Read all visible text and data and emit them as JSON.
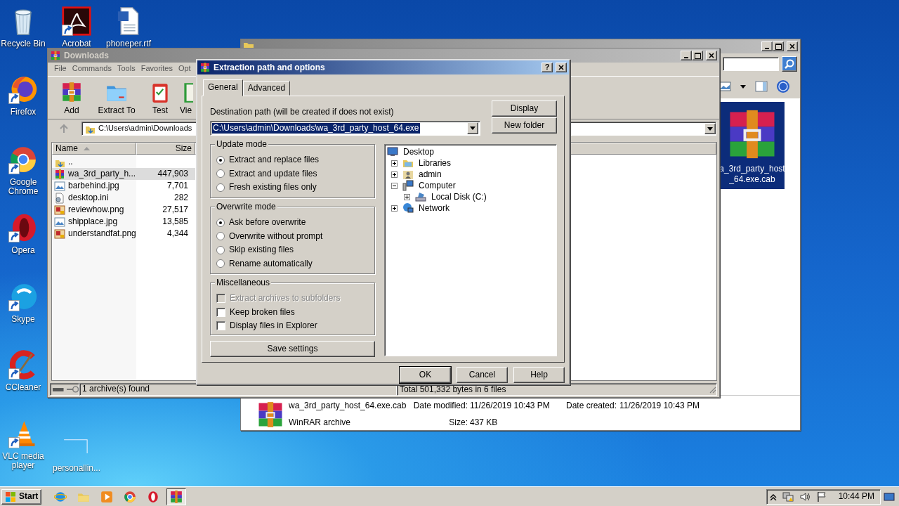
{
  "desktop_icons": [
    {
      "label": "Recycle Bin",
      "kind": "bin"
    },
    {
      "label": "Firefox",
      "kind": "firefox"
    },
    {
      "label": "Google Chrome",
      "kind": "chrome"
    },
    {
      "label": "Opera",
      "kind": "opera"
    },
    {
      "label": "Skype",
      "kind": "skype"
    },
    {
      "label": "CCleaner",
      "kind": "ccleaner"
    },
    {
      "label": "VLC media player",
      "kind": "vlc"
    },
    {
      "label": "Acrobat",
      "kind": "acrobat"
    },
    {
      "label": "phoneper.rtf",
      "kind": "word"
    },
    {
      "label": "personallin...",
      "kind": "blank"
    }
  ],
  "explorer": {
    "tile": {
      "label_lines": [
        "a_3rd_party_host",
        "_64.exe.cab"
      ],
      "selected": true
    },
    "details": {
      "name": "wa_3rd_party_host_64.exe.cab",
      "type": "WinRAR archive",
      "modified_label": "Date modified:",
      "modified": "11/26/2019 10:43 PM",
      "created_label": "Date created:",
      "created": "11/26/2019 10:43 PM",
      "size_label": "Size:",
      "size": "437 KB"
    }
  },
  "winrar": {
    "title": "Downloads",
    "menu": [
      "File",
      "Commands",
      "Tools",
      "Favorites",
      "Opt"
    ],
    "toolbar": [
      {
        "label": "Add",
        "kind": "add"
      },
      {
        "label": "Extract To",
        "kind": "extract"
      },
      {
        "label": "Test",
        "kind": "test"
      },
      {
        "label": "Vie",
        "kind": "view"
      }
    ],
    "address": "C:\\Users\\admin\\Downloads",
    "columns": [
      "Name",
      "Size"
    ],
    "files": [
      {
        "name": "..",
        "kind": "up",
        "selected": false
      },
      {
        "name": "wa_3rd_party_h...",
        "size": "447,903",
        "kind": "archive",
        "selected": true
      },
      {
        "name": "barbehind.jpg",
        "size": "7,701",
        "kind": "jpg",
        "selected": false
      },
      {
        "name": "desktop.ini",
        "size": "282",
        "kind": "ini",
        "selected": false
      },
      {
        "name": "reviewhow.png",
        "size": "27,517",
        "kind": "png",
        "selected": false
      },
      {
        "name": "shipplace.jpg",
        "size": "13,585",
        "kind": "jpg",
        "selected": false
      },
      {
        "name": "understandfat.png",
        "size": "4,344",
        "kind": "png",
        "selected": false
      }
    ],
    "status_left": "1 archive(s) found",
    "status_right": "Total 501,332 bytes in 6 files"
  },
  "dialog": {
    "title": "Extraction path and options",
    "help_button": "?",
    "tabs": [
      {
        "label": "General",
        "selected": true
      },
      {
        "label": "Advanced",
        "selected": false
      }
    ],
    "destination_label": "Destination path (will be created if does not exist)",
    "destination": "C:\\Users\\admin\\Downloads\\wa_3rd_party_host_64.exe",
    "side_buttons": [
      "Display",
      "New folder"
    ],
    "update_mode": {
      "title": "Update mode",
      "options": [
        {
          "label": "Extract and replace files",
          "selected": true
        },
        {
          "label": "Extract and update files",
          "selected": false
        },
        {
          "label": "Fresh existing files only",
          "selected": false
        }
      ]
    },
    "overwrite_mode": {
      "title": "Overwrite mode",
      "options": [
        {
          "label": "Ask before overwrite",
          "selected": true
        },
        {
          "label": "Overwrite without prompt",
          "selected": false
        },
        {
          "label": "Skip existing files",
          "selected": false
        },
        {
          "label": "Rename automatically",
          "selected": false
        }
      ]
    },
    "miscellaneous": {
      "title": "Miscellaneous",
      "options": [
        {
          "label": "Extract archives to subfolders",
          "checked": false,
          "disabled": true
        },
        {
          "label": "Keep broken files",
          "checked": false,
          "disabled": false
        },
        {
          "label": "Display files in Explorer",
          "checked": false,
          "disabled": false
        }
      ]
    },
    "save_button": "Save settings",
    "tree": [
      {
        "label": "Desktop",
        "kind": "desktop",
        "children": [
          {
            "label": "Libraries",
            "kind": "library",
            "expanded": false
          },
          {
            "label": "admin",
            "kind": "user",
            "expanded": false
          },
          {
            "label": "Computer",
            "kind": "computer",
            "expanded": true,
            "children": [
              {
                "label": "Local Disk (C:)",
                "kind": "disk",
                "expanded": false
              }
            ]
          },
          {
            "label": "Network",
            "kind": "network",
            "expanded": false
          }
        ]
      }
    ],
    "buttons": [
      "OK",
      "Cancel",
      "Help"
    ]
  },
  "taskbar": {
    "start": "Start",
    "apps": [
      {
        "kind": "ie",
        "selected": false
      },
      {
        "kind": "explorer",
        "selected": false
      },
      {
        "kind": "media",
        "selected": false
      },
      {
        "kind": "chrome",
        "selected": false
      },
      {
        "kind": "opera",
        "selected": false
      },
      {
        "kind": "winrar",
        "selected": true
      }
    ],
    "clock": "10:44 PM"
  }
}
